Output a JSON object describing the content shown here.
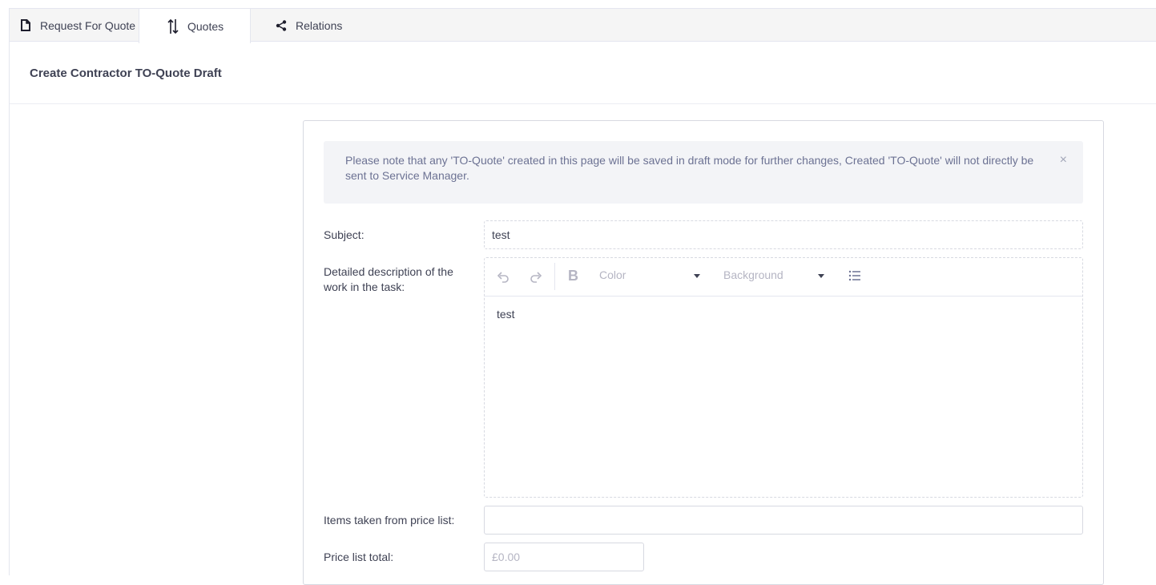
{
  "tabs": [
    {
      "label": "Request For Quote",
      "icon": "document-icon"
    },
    {
      "label": "Quotes",
      "icon": "sort-arrows-icon",
      "active": true
    },
    {
      "label": "Relations",
      "icon": "share-icon"
    }
  ],
  "page": {
    "title": "Create Contractor TO-Quote Draft"
  },
  "alert": {
    "text": "Please note that any 'TO-Quote' created in this page will be saved in draft mode for further changes, Created 'TO-Quote' will not directly be sent to Service Manager.",
    "close_glyph": "×"
  },
  "form": {
    "subject_label": "Subject:",
    "subject_value": "test",
    "description_label": "Detailed description of the work in the task:",
    "editor": {
      "bold_label": "B",
      "color_label": "Color",
      "background_label": "Background",
      "body_text": "test"
    },
    "items_label": "Items taken from price list:",
    "items_value": "",
    "price_total_label": "Price list total:",
    "price_total_placeholder": "£0.00"
  }
}
